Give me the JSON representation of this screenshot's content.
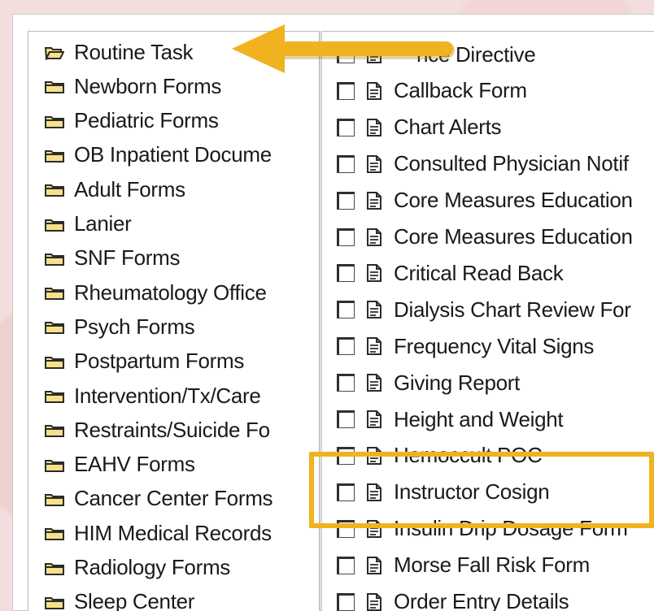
{
  "folders": [
    {
      "label": "Routine Task",
      "icon": "open-folder-icon"
    },
    {
      "label": "Newborn Forms",
      "icon": "folder-icon"
    },
    {
      "label": "Pediatric  Forms",
      "icon": "folder-icon"
    },
    {
      "label": "OB Inpatient Docume",
      "icon": "folder-icon"
    },
    {
      "label": "Adult Forms",
      "icon": "folder-icon"
    },
    {
      "label": "Lanier",
      "icon": "folder-icon"
    },
    {
      "label": "SNF Forms",
      "icon": "folder-icon"
    },
    {
      "label": "Rheumatology Office",
      "icon": "folder-icon"
    },
    {
      "label": "Psych Forms",
      "icon": "folder-icon"
    },
    {
      "label": "Postpartum Forms",
      "icon": "folder-icon"
    },
    {
      "label": "Intervention/Tx/Care",
      "icon": "folder-icon"
    },
    {
      "label": "Restraints/Suicide Fo",
      "icon": "folder-icon"
    },
    {
      "label": "EAHV Forms",
      "icon": "folder-icon"
    },
    {
      "label": "Cancer Center Forms",
      "icon": "folder-icon"
    },
    {
      "label": "HIM Medical Records",
      "icon": "folder-icon"
    },
    {
      "label": "Radiology Forms",
      "icon": "folder-icon"
    },
    {
      "label": "Sleep Center",
      "icon": "folder-icon"
    }
  ],
  "forms": [
    {
      "label": "nce Directive"
    },
    {
      "label": "Callback Form"
    },
    {
      "label": "Chart Alerts"
    },
    {
      "label": "Consulted Physician Notif"
    },
    {
      "label": "Core Measures Education"
    },
    {
      "label": "Core Measures Education"
    },
    {
      "label": "Critical Read Back"
    },
    {
      "label": "Dialysis Chart Review For"
    },
    {
      "label": "Frequency Vital Signs"
    },
    {
      "label": "Giving Report"
    },
    {
      "label": "Height and Weight"
    },
    {
      "label": "Hemoccult POC"
    },
    {
      "label": "Instructor Cosign"
    },
    {
      "label": "Insulin Drip Dosage Form"
    },
    {
      "label": "Morse Fall Risk Form"
    },
    {
      "label": "Order Entry Details"
    }
  ],
  "colors": {
    "annotation": "#f0b21e",
    "folder_fill": "#f7e08a",
    "folder_outline": "#2b2b2b"
  }
}
